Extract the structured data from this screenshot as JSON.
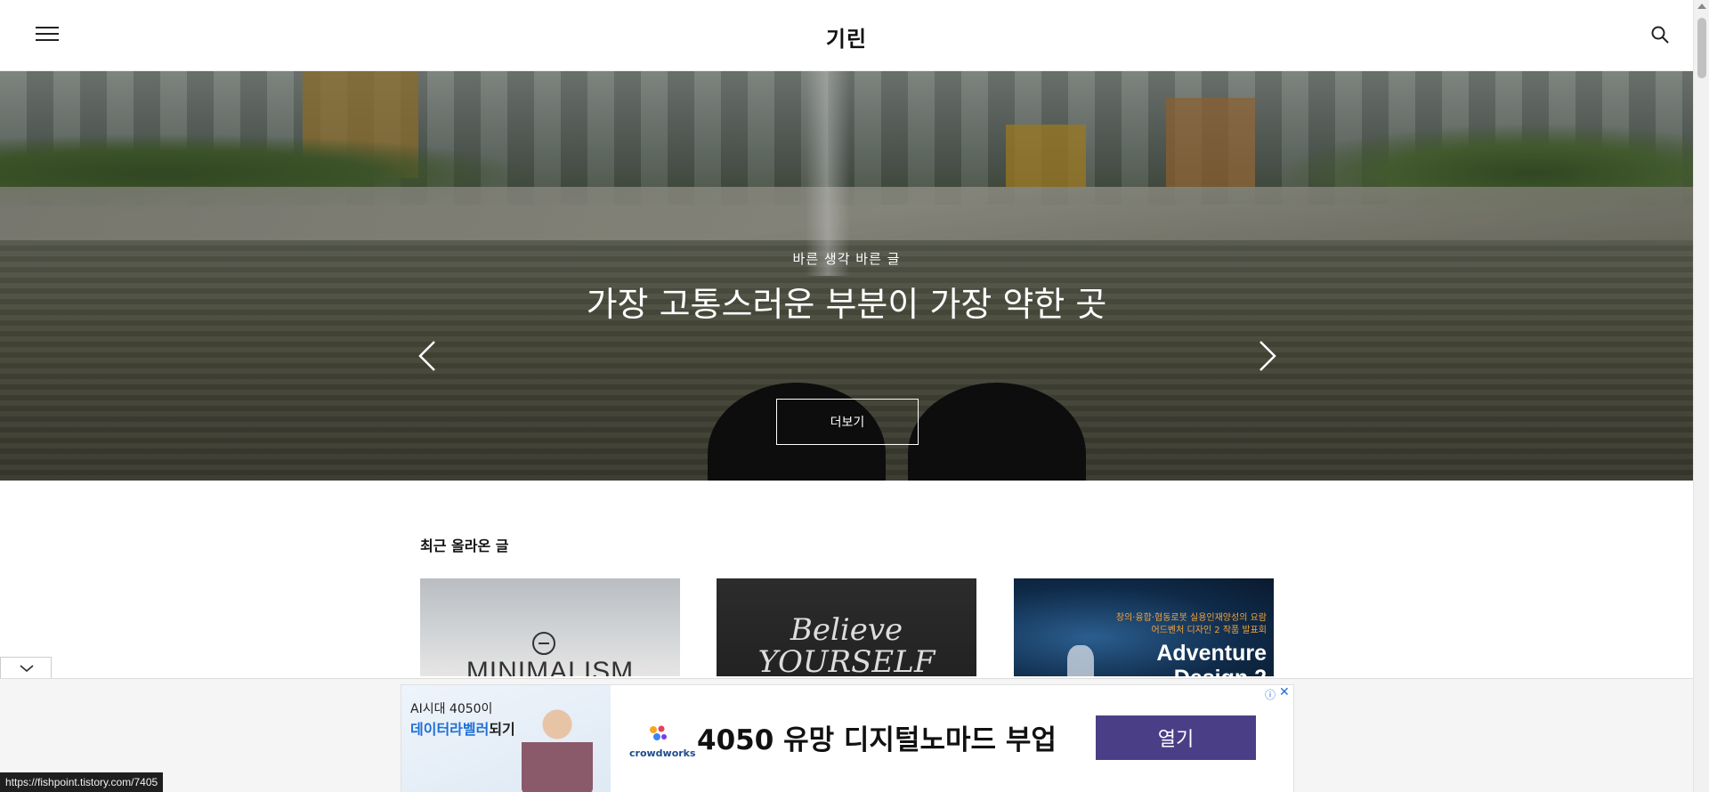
{
  "header": {
    "site_title": "기린",
    "menu_icon": "hamburger-menu-icon",
    "search_icon": "search-icon"
  },
  "hero": {
    "subtitle": "바른 생각 바른 글",
    "title": "가장 고통스러운 부분이 가장 약한 곳",
    "more_button": "더보기",
    "prev_icon": "chevron-left-icon",
    "next_icon": "chevron-right-icon"
  },
  "recent": {
    "heading": "최근 올라온 글",
    "cards": [
      {
        "image_text": "MINIMALISM"
      },
      {
        "image_text": "Believe YOURSELF"
      },
      {
        "image_top_line1": "창의·융합·협동로봇 실용인재양성의 요람",
        "image_top_line2": "어드벤처 디자인 2 작품 발표회",
        "image_title_line1": "Adventure",
        "image_title_line2": "Design 2"
      }
    ]
  },
  "ad": {
    "img_line1": "AI시대 4050이",
    "img_line2_highlight": "데이터라벨러",
    "img_line2_rest": "되기",
    "brand": "crowdworks",
    "headline": "4050 유망 디지털노마드 부업",
    "cta": "열기",
    "info_icon": "ⓘ",
    "close_icon": "✕"
  },
  "status_bar": {
    "url": "https://fishpoint.tistory.com/7405"
  },
  "colors": {
    "ad_cta_bg": "#4a3f87",
    "ad_highlight": "#1e6fd6",
    "card3_accent": "#f4a33c"
  }
}
